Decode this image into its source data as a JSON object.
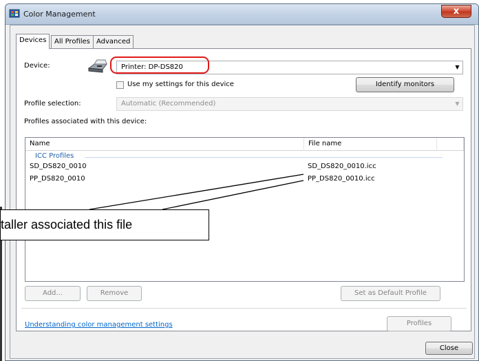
{
  "window": {
    "title": "Color Management",
    "close_glyph": "x"
  },
  "tabs": [
    {
      "label": "Devices",
      "active": true
    },
    {
      "label": "All Profiles",
      "active": false
    },
    {
      "label": "Advanced",
      "active": false
    }
  ],
  "device": {
    "label": "Device:",
    "selected": "Printer: DP-DS820",
    "use_settings_label": "Use my settings for this device",
    "use_settings_checked": false,
    "identify_button": "Identify monitors"
  },
  "profile_selection": {
    "label": "Profile selection:",
    "value": "Automatic (Recommended)"
  },
  "profiles_list": {
    "heading": "Profiles associated with this device:",
    "columns": [
      "Name",
      "File name"
    ],
    "group": "ICC Profiles",
    "rows": [
      {
        "name": "SD_DS820_0010",
        "file": "SD_DS820_0010.icc"
      },
      {
        "name": "PP_DS820_0010",
        "file": "PP_DS820_0010.icc"
      }
    ]
  },
  "buttons": {
    "add": "Add...",
    "remove": "Remove",
    "set_default": "Set as Default Profile",
    "profiles": "Profiles",
    "close": "Close"
  },
  "link": "Understanding color management settings",
  "callout": "taller associated this file",
  "colors": {
    "accent_red": "#e01818",
    "link_blue": "#0066cc",
    "group_blue": "#1f5fa8"
  },
  "icons": {
    "title": "color-management-icon",
    "device": "printer-icon",
    "dropdown": "chevron-down-icon"
  }
}
